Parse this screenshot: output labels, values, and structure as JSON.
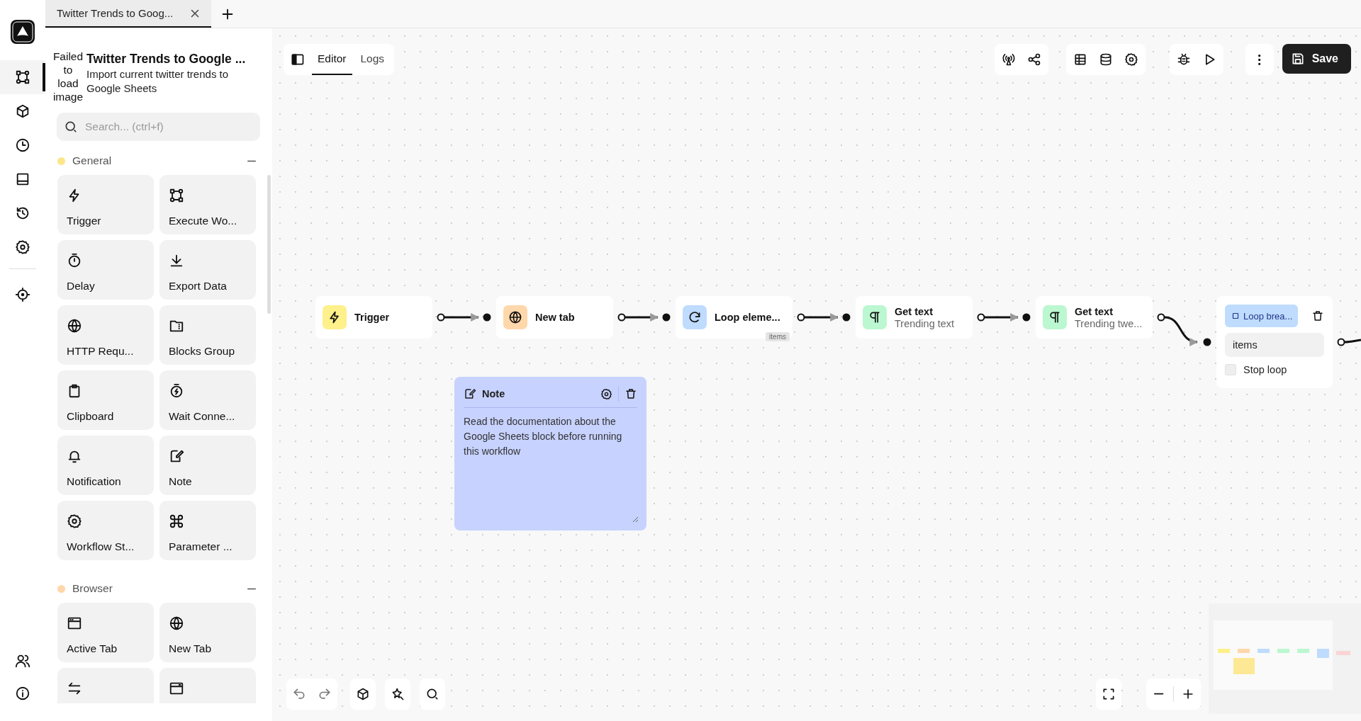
{
  "tab": {
    "title": "Twitter Trends to Goog..."
  },
  "rail_items": [
    {
      "selected": true
    },
    {
      "selected": false
    },
    {
      "selected": false
    },
    {
      "selected": false
    },
    {
      "selected": false
    },
    {
      "selected": false
    },
    {
      "selected": false
    }
  ],
  "workflow": {
    "image_alt": "Failed to load image",
    "title": "Twitter Trends to Google ...",
    "description": "Import current twitter trends to Google Sheets"
  },
  "search": {
    "placeholder": "Search... (ctrl+f)"
  },
  "categories": [
    {
      "name": "General",
      "color": "#fde68a",
      "blocks": [
        {
          "kind": "block",
          "label": "Trigger"
        },
        {
          "kind": "block",
          "label": "Execute Wo..."
        },
        {
          "kind": "block",
          "label": "Delay"
        },
        {
          "kind": "block",
          "label": "Export Data"
        },
        {
          "kind": "block",
          "label": "HTTP Requ..."
        },
        {
          "kind": "block",
          "label": "Blocks Group"
        },
        {
          "kind": "block",
          "label": "Clipboard"
        },
        {
          "kind": "block",
          "label": "Wait Conne..."
        },
        {
          "kind": "block",
          "label": "Notification"
        },
        {
          "kind": "block",
          "label": "Note"
        },
        {
          "kind": "block",
          "label": "Workflow St..."
        },
        {
          "kind": "block",
          "label": "Parameter ..."
        }
      ]
    },
    {
      "name": "Browser",
      "color": "#fed7aa",
      "blocks": [
        {
          "kind": "block",
          "label": "Active Tab"
        },
        {
          "kind": "block",
          "label": "New Tab"
        },
        {
          "kind": "block"
        },
        {
          "kind": "block"
        }
      ]
    }
  ],
  "editor_tabs": [
    {
      "label": "Editor",
      "selected": true
    },
    {
      "label": "Logs",
      "selected": false
    }
  ],
  "save_button": {
    "label": "Save"
  },
  "nodes": [
    {
      "kind": "block",
      "title": "Trigger",
      "color": "#fef08a"
    },
    {
      "kind": "block",
      "title": "New tab",
      "color": "#fed7aa"
    },
    {
      "kind": "block",
      "title": "Loop eleme...",
      "badge": "items",
      "color": "#bfdbfe"
    },
    {
      "kind": "block",
      "title": "Get text",
      "subtitle": "Trending text",
      "color": "#bbf7d0"
    },
    {
      "kind": "block",
      "title": "Get text",
      "subtitle": "Trending twe...",
      "color": "#bbf7d0"
    },
    {
      "kind": "breakpoint",
      "title": "Loop brea...",
      "color": "#bfdbfe",
      "field_value": "items",
      "checkbox_label": "Stop loop",
      "checked": false
    }
  ],
  "note": {
    "title": "Note",
    "text": "Read the documentation about the Google Sheets block before running this workflow",
    "color": "#c7d2fe"
  }
}
